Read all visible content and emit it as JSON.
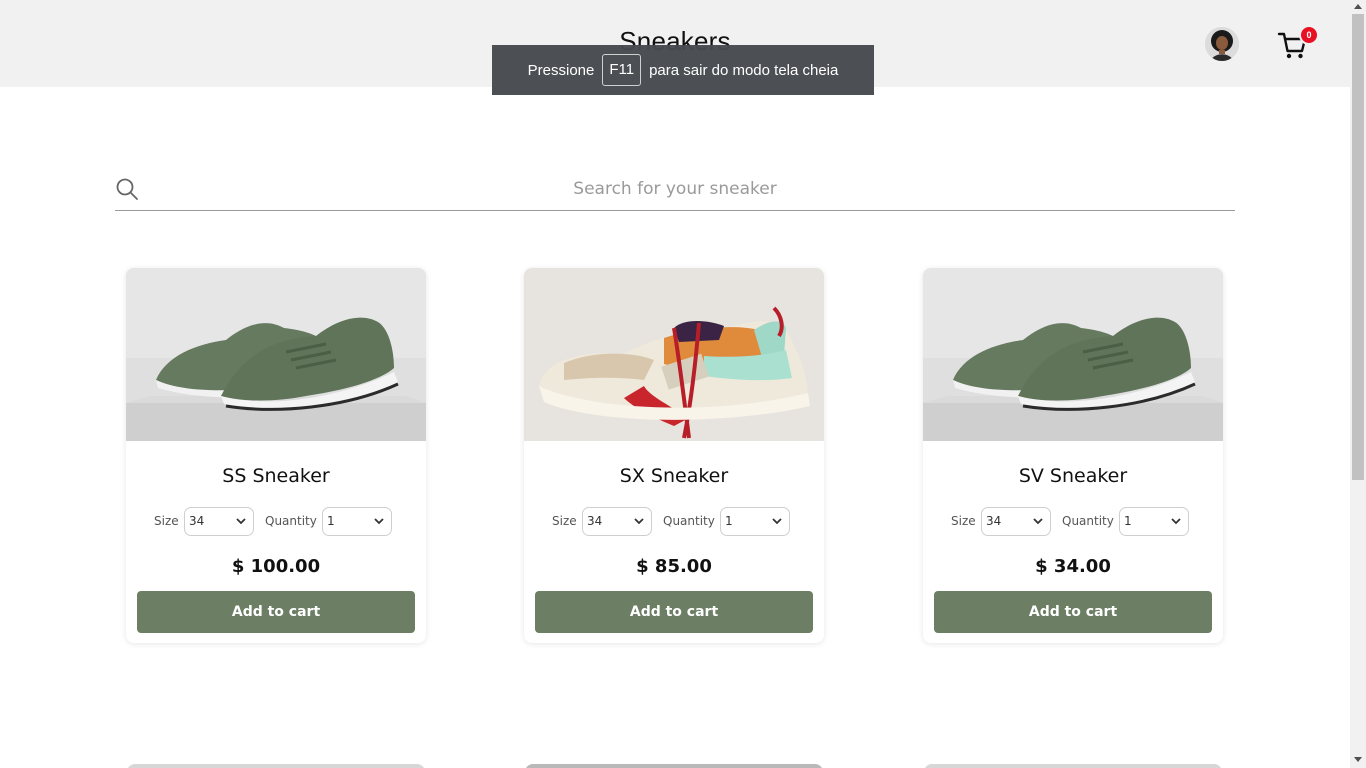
{
  "header": {
    "title": "Sneakers",
    "cart_count": "0"
  },
  "fullscreen_toast": {
    "prefix": "Pressione",
    "key": "F11",
    "suffix": "para sair do modo tela cheia"
  },
  "search": {
    "placeholder": "Search for your sneaker",
    "value": ""
  },
  "products": [
    {
      "name": "SS Sneaker",
      "size_label": "Size",
      "size": "34",
      "quantity_label": "Quantity",
      "quantity": "1",
      "price": "$ 100.00",
      "button": "Add to cart",
      "image": "green-sneaker"
    },
    {
      "name": "SX Sneaker",
      "size_label": "Size",
      "size": "34",
      "quantity_label": "Quantity",
      "quantity": "1",
      "price": "$ 85.00",
      "button": "Add to cart",
      "image": "multicolor-sneaker"
    },
    {
      "name": "SV Sneaker",
      "size_label": "Size",
      "size": "34",
      "quantity_label": "Quantity",
      "quantity": "1",
      "price": "$ 34.00",
      "button": "Add to cart",
      "image": "green-sneaker"
    }
  ],
  "colors": {
    "button": "#6c7f65",
    "header_bg": "#f1f1f1",
    "badge": "#e81123"
  },
  "icons": {
    "search": "search-icon",
    "cart": "cart-icon",
    "avatar": "user-avatar",
    "select_arrow": "chevron-down-icon"
  }
}
